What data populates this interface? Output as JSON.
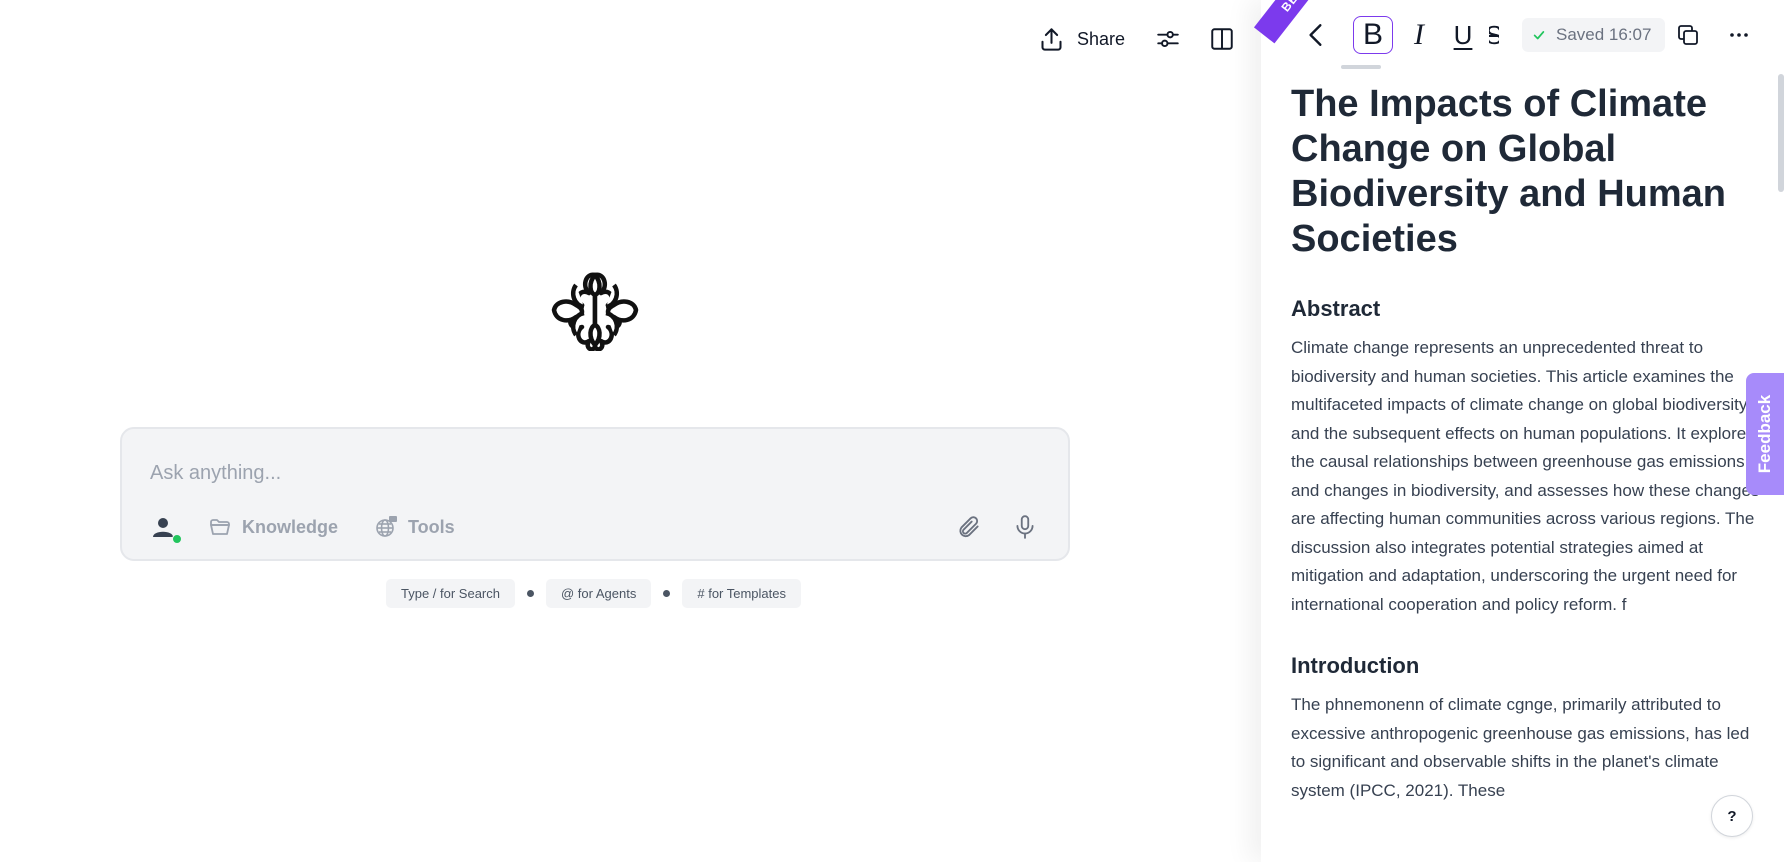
{
  "toolbar": {
    "share_label": "Share"
  },
  "assistant": {
    "placeholder": "Ask anything...",
    "knowledge_label": "Knowledge",
    "tools_label": "Tools",
    "hints": [
      "Type / for Search",
      "@ for Agents",
      "# for Templates"
    ]
  },
  "doc": {
    "beta_label": "BETA",
    "format": {
      "bold": "B",
      "italic": "I",
      "underline": "U",
      "strike": "S"
    },
    "saved_text": "Saved 16:07",
    "title": "The Impacts of Climate Change on Global Biodiversity and Human Societies",
    "abstract_heading": "Abstract",
    "abstract_text": "Climate change represents an unprecedented threat to biodiversity and human societies. This article examines the multifaceted impacts of climate change on global biodiversity and the subsequent effects on human populations. It explores the causal relationships between greenhouse gas emissions and changes in biodiversity, and assesses how these changes are affecting human communities across various regions. The discussion also integrates potential strategies aimed at mitigation and adaptation, underscoring the urgent need for international cooperation and policy reform. f",
    "intro_heading": "Introduction",
    "intro_text": "The phnemonenn of climate cgnge, primarily attributed to excessive anthropogenic greenhouse gas emissions, has led to significant and observable shifts in the planet's climate system (IPCC, 2021). These"
  },
  "side": {
    "feedback_label": "Feedback",
    "help_label": "?"
  },
  "colors": {
    "accent": "#7c3aed",
    "feedback": "#a78bfa",
    "online": "#22c55e"
  }
}
